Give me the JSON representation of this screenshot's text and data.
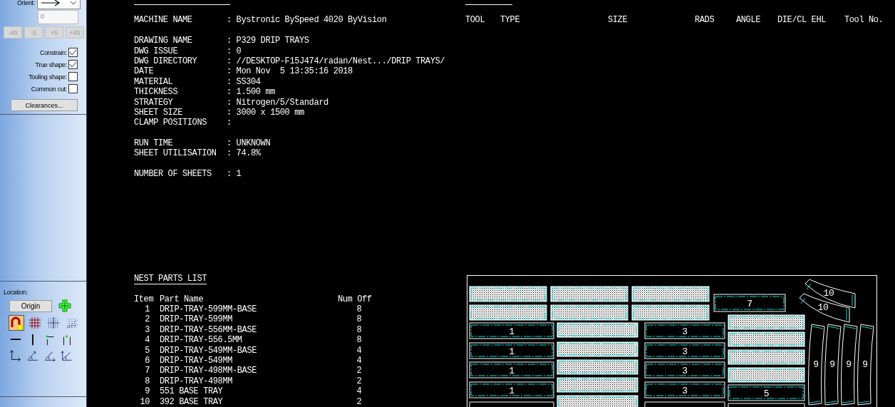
{
  "side_panel": {
    "orient_label": "Orient:",
    "angle_field": {
      "value": "0",
      "disabled": true
    },
    "angle_buttons": [
      {
        "label": "-45",
        "disabled": true
      },
      {
        "label": "-5",
        "disabled": true
      },
      {
        "label": "+5",
        "disabled": true
      },
      {
        "label": "+45",
        "disabled": true
      }
    ],
    "options": [
      {
        "label": "Constrain:",
        "checked": true
      },
      {
        "label": "True shape:",
        "checked": true
      },
      {
        "label": "Tooling shape:",
        "checked": false
      },
      {
        "label": "Common cut:",
        "checked": false
      }
    ],
    "clearances_button": "Clearances...",
    "location_label": "Location:",
    "origin_button": "Origin",
    "snap_tools": [
      {
        "selected": true
      },
      {
        "selected": false
      },
      {
        "selected": false
      },
      {
        "selected": false
      }
    ]
  },
  "setting_information": {
    "groups": [
      [
        {
          "label": "MACHINE NAME",
          "value": ": Bystronic BySpeed 4020 ByVision"
        }
      ],
      [
        {
          "label": "DRAWING NAME",
          "value": ": P329 DRIP TRAYS"
        },
        {
          "label": "DWG ISSUE",
          "value": ": 0"
        },
        {
          "label": "DWG DIRECTORY",
          "value": ": //DESKTOP-F15J474/radan/Nest.../DRIP TRAYS/"
        },
        {
          "label": "DATE",
          "value": ": Mon Nov  5 13:35:16 2018"
        },
        {
          "label": "MATERIAL",
          "value": ": SS304"
        },
        {
          "label": "THICKNESS",
          "value": ": 1.500 mm"
        },
        {
          "label": "STRATEGY",
          "value": ": Nitrogen/5/Standard"
        },
        {
          "label": "SHEET SIZE",
          "value": ": 3000 x 1500 mm"
        },
        {
          "label": "CLAMP POSITIONS",
          "value": ":"
        }
      ],
      [
        {
          "label": "RUN TIME",
          "value": ": UNKNOWN"
        },
        {
          "label": "SHEET UTILISATION",
          "value": ": 74.8%"
        }
      ],
      [
        {
          "label": "NUMBER OF SHEETS",
          "value": ": 1"
        }
      ]
    ]
  },
  "tool_list": {
    "columns": [
      "TOOL",
      "TYPE",
      "SIZE",
      "RADS",
      "ANGLE",
      "DIE/CL EHL",
      "Tool No."
    ]
  },
  "nest_parts_list": {
    "title": "NEST PARTS LIST",
    "columns": [
      "Item",
      "Part Name",
      "Num Off"
    ],
    "rows": [
      {
        "item": "1",
        "name": "DRIP-TRAY-599MM-BASE",
        "num": "8"
      },
      {
        "item": "2",
        "name": "DRIP-TRAY-599MM",
        "num": "8"
      },
      {
        "item": "3",
        "name": "DRIP-TRAY-556MM-BASE",
        "num": "8"
      },
      {
        "item": "4",
        "name": "DRIP-TRAY-556.5MM",
        "num": "8"
      },
      {
        "item": "5",
        "name": "DRIP-TRAY-549MM-BASE",
        "num": "4"
      },
      {
        "item": "6",
        "name": "DRIP-TRAY-549MM",
        "num": "4"
      },
      {
        "item": "7",
        "name": "DRIP-TRAY-498MM-BASE",
        "num": "2"
      },
      {
        "item": "8",
        "name": "DRIP-TRAY-498MM",
        "num": "2"
      },
      {
        "item": "9",
        "name": "551 BASE TRAY",
        "num": "4"
      },
      {
        "item": "10",
        "name": "392 BASE TRAY",
        "num": "2"
      }
    ]
  },
  "nest_drawing": {
    "part_labels": [
      "7",
      "10",
      "10",
      "1",
      "1",
      "1",
      "1",
      "3",
      "3",
      "3",
      "3",
      "5",
      "9",
      "9",
      "9",
      "9"
    ]
  }
}
